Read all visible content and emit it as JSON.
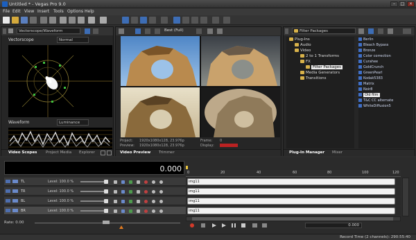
{
  "window": {
    "title": "Untitled * - Vegas Pro 9.0"
  },
  "menu": [
    "File",
    "Edit",
    "View",
    "Insert",
    "Tools",
    "Options",
    "Help"
  ],
  "scopes": {
    "dropdown": "Vectorscope/Waveform",
    "vectorscope_label": "Vectorscope",
    "vectorscope_mode": "Normal",
    "waveform_label": "Waveform",
    "waveform_mode": "Luminance",
    "tabs": [
      "Video Scopes",
      "Project Media",
      "Explorer"
    ]
  },
  "preview": {
    "quality": "Best (Full)",
    "project_label": "Project:",
    "project_value": "1920x1080x128, 23.976p",
    "preview_label": "Preview:",
    "preview_value": "1920x1080x128, 23.976p",
    "frame_label": "Frame:",
    "frame_value": "0",
    "display_label": "Display:",
    "tabs": [
      "Video Preview",
      "Trimmer"
    ]
  },
  "plugins": {
    "dropdown": "Filter Packages",
    "tree": [
      "Plug-Ins",
      "Audio",
      "Video",
      "2 to 1 Transforms",
      "FX",
      "Filter Packages",
      "Media Generators",
      "Transitions"
    ],
    "fx_list": [
      "Berlin",
      "Bleach Bypass",
      "Bronze",
      "Color correction",
      "Curahee",
      "GoldCrunch",
      "GreenPearl",
      "Kodak5383",
      "Matrix",
      "Noir8",
      "Old film",
      "T&C CC alternate",
      "WhiteDiffusion5"
    ],
    "selected": "Old film",
    "tabs": [
      "Plug-In Manager",
      "Mixer"
    ]
  },
  "timeline": {
    "timecode": "0.000",
    "ruler": [
      "0",
      "20",
      "40",
      "60",
      "80",
      "100",
      "120"
    ],
    "tracks": [
      {
        "name": "TL",
        "level": "Level: 100.0 %",
        "clip": "img11"
      },
      {
        "name": "TR",
        "level": "Level: 100.0 %",
        "clip": "img11"
      },
      {
        "name": "BL",
        "level": "Level: 100.0 %",
        "clip": "img11"
      },
      {
        "name": "BR",
        "level": "Level: 100.0 %",
        "clip": "img11"
      }
    ],
    "rate": "Rate: 0.00",
    "position": "0.000",
    "status": "Record Time (2 channels): 290:55:40"
  }
}
